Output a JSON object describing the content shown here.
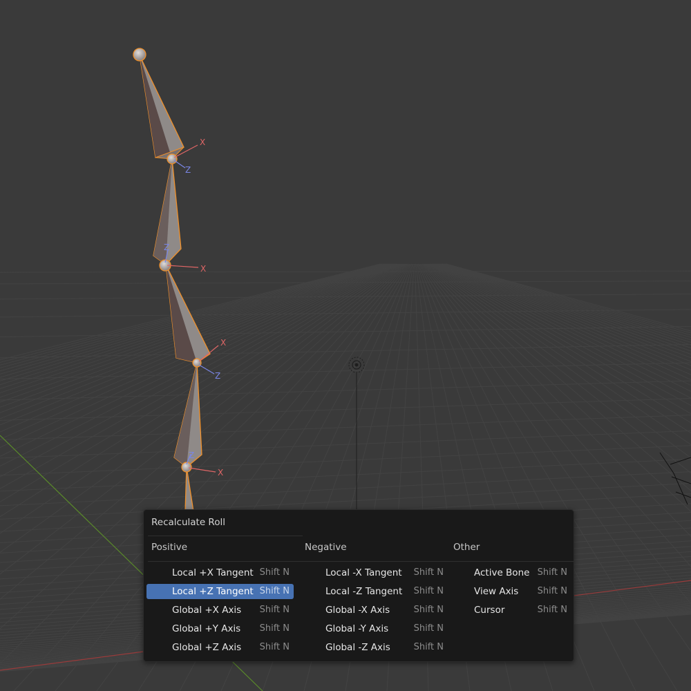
{
  "viewport": {
    "axis_labels": {
      "x": "X",
      "z": "Z"
    },
    "colors": {
      "background": "#3a3a3a",
      "grid": "#434343",
      "grid_major": "#4a4a4a",
      "x_axis_line": "#9a3b3b",
      "y_axis_line": "#5a8a2a",
      "bone_fill": "#8f8a88",
      "bone_dark": "#5a4a48",
      "bone_outline": "#f0902a",
      "axis_x": "#e06666",
      "axis_z": "#7a86e6"
    }
  },
  "menu": {
    "title": "Recalculate Roll",
    "columns": [
      {
        "heading": "Positive",
        "items": [
          {
            "label": "Local +X Tangent",
            "shortcut": "Shift N",
            "active": false
          },
          {
            "label": "Local +Z Tangent",
            "shortcut": "Shift N",
            "active": true
          },
          {
            "label": "Global +X Axis",
            "shortcut": "Shift N",
            "active": false
          },
          {
            "label": "Global +Y Axis",
            "shortcut": "Shift N",
            "active": false
          },
          {
            "label": "Global +Z Axis",
            "shortcut": "Shift N",
            "active": false
          }
        ]
      },
      {
        "heading": "Negative",
        "items": [
          {
            "label": "Local -X Tangent",
            "shortcut": "Shift N",
            "active": false
          },
          {
            "label": "Local -Z Tangent",
            "shortcut": "Shift N",
            "active": false
          },
          {
            "label": "Global -X Axis",
            "shortcut": "Shift N",
            "active": false
          },
          {
            "label": "Global -Y Axis",
            "shortcut": "Shift N",
            "active": false
          },
          {
            "label": "Global -Z Axis",
            "shortcut": "Shift N",
            "active": false
          }
        ]
      },
      {
        "heading": "Other",
        "items": [
          {
            "label": "Active Bone",
            "shortcut": "Shift N",
            "active": false
          },
          {
            "label": "View Axis",
            "shortcut": "Shift N",
            "active": false
          },
          {
            "label": "Cursor",
            "shortcut": "Shift N",
            "active": false
          }
        ]
      }
    ],
    "colors": {
      "background": "#191919",
      "highlight": "#4772b3",
      "text": "#e6e6e6",
      "shortcut": "#8c8c8c"
    }
  }
}
